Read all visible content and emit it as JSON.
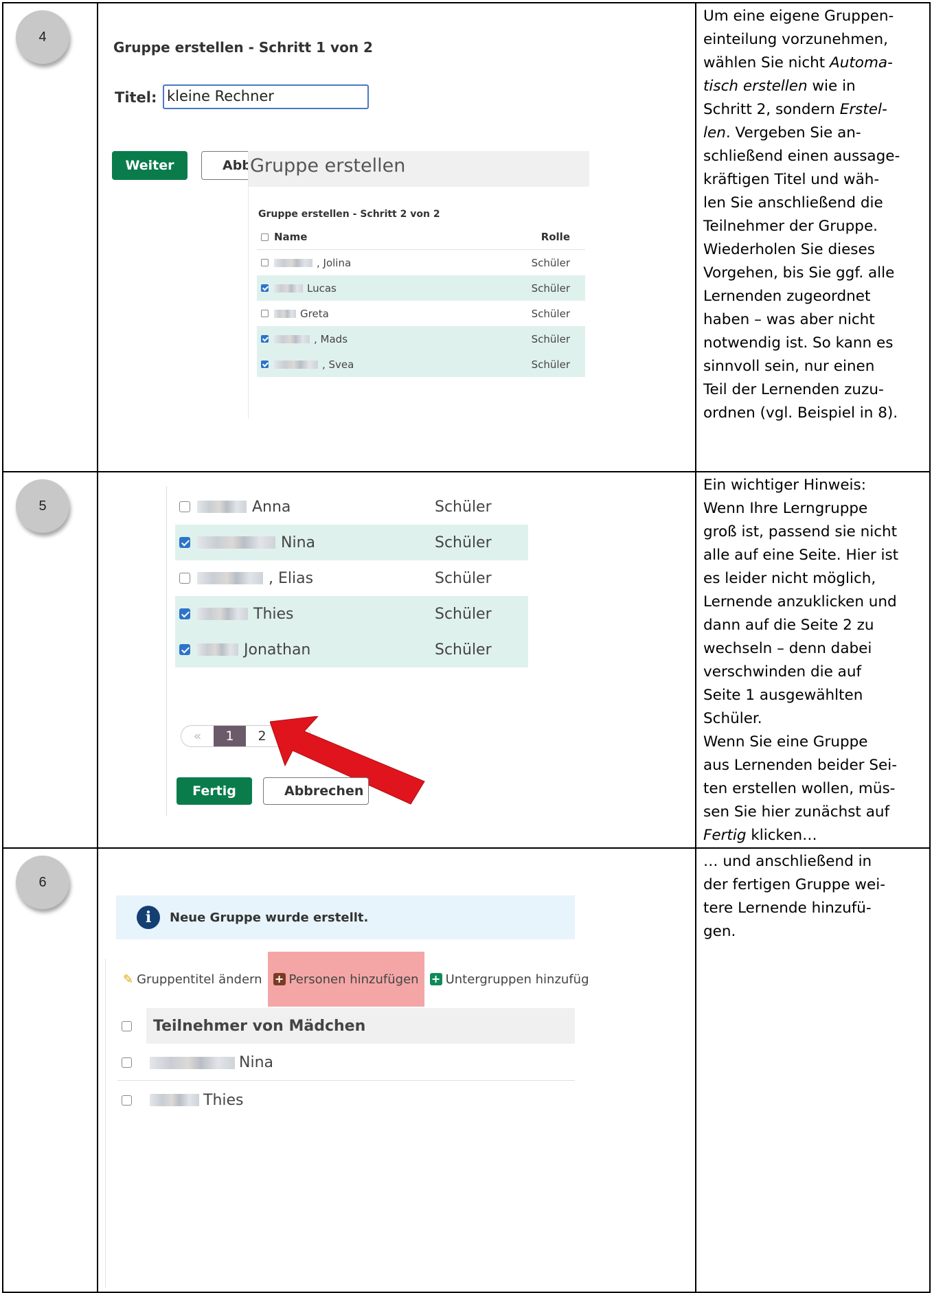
{
  "rows": [
    {
      "step": "4",
      "desc": [
        {
          "t": "Um eine eigene Gruppen-"
        },
        {
          "t": "einteilung vorzunehmen,"
        },
        {
          "t": "wählen Sie nicht ",
          "i": "Automa-"
        },
        {
          "i": "tisch erstellen",
          "t2": " wie in"
        },
        {
          "t": "Schritt 2, sondern ",
          "i": "Erstel-"
        },
        {
          "i": "len",
          "t2": ". Vergeben Sie an-"
        },
        {
          "t": "schließend einen aussage-"
        },
        {
          "t": "kräftigen Titel und wäh-"
        },
        {
          "t": "len Sie anschließend die"
        },
        {
          "t": "Teilnehmer der Gruppe."
        },
        {
          "t": "Wiederholen Sie dieses"
        },
        {
          "t": "Vorgehen, bis Sie ggf. alle"
        },
        {
          "t": "Lernenden zugeordnet"
        },
        {
          "t": "haben – was aber nicht"
        },
        {
          "t": "notwendig ist. So kann es"
        },
        {
          "t": "sinnvoll sein, nur einen"
        },
        {
          "t": "Teil der Lernenden zuzu-"
        },
        {
          "t": "ordnen (vgl. Beispiel in 8)."
        }
      ]
    },
    {
      "step": "5",
      "desc": [
        {
          "t": "Ein wichtiger Hinweis:"
        },
        {
          "t": "Wenn Ihre Lerngruppe"
        },
        {
          "t": "groß ist, passend sie nicht"
        },
        {
          "t": "alle auf eine Seite. Hier ist"
        },
        {
          "t": "es leider nicht möglich,"
        },
        {
          "t": "Lernende anzuklicken und"
        },
        {
          "t": "dann auf die Seite 2 zu"
        },
        {
          "t": "wechseln – denn dabei"
        },
        {
          "t": "verschwinden die auf"
        },
        {
          "t": "Seite 1 ausgewählten"
        },
        {
          "t": "Schüler."
        },
        {
          "t": "Wenn Sie eine Gruppe"
        },
        {
          "t": "aus Lernenden beider Sei-"
        },
        {
          "t": "ten erstellen wollen, müs-"
        },
        {
          "t": "sen Sie hier zunächst auf"
        },
        {
          "i": "Fertig",
          "t2": " klicken…"
        }
      ]
    },
    {
      "step": "6",
      "desc": [
        {
          "t": "… und anschließend in"
        },
        {
          "t": "der fertigen Gruppe wei-"
        },
        {
          "t": "tere Lernende hinzufü-"
        },
        {
          "t": "gen."
        }
      ]
    }
  ],
  "step1": {
    "title": "Gruppe erstellen - Schritt 1 von 2",
    "label": "Titel:",
    "input_value": "kleine Rechner",
    "next": "Weiter",
    "cancel": "Abbre"
  },
  "step2": {
    "panel_title": "Gruppe erstellen",
    "subtitle": "Gruppe erstellen - Schritt 2 von 2",
    "col_name": "Name",
    "col_role": "Rolle",
    "people": [
      {
        "name": ", Jolina",
        "role": "Schüler",
        "checked": false
      },
      {
        "name": "Lucas",
        "role": "Schüler",
        "checked": true
      },
      {
        "name": "Greta",
        "role": "Schüler",
        "checked": false
      },
      {
        "name": ", Mads",
        "role": "Schüler",
        "checked": true
      },
      {
        "name": ", Svea",
        "role": "Schüler",
        "checked": true
      }
    ]
  },
  "page1": {
    "people": [
      {
        "name": "Anna",
        "role": "Schüler",
        "checked": false
      },
      {
        "name": "Nina",
        "role": "Schüler",
        "checked": true
      },
      {
        "name": ", Elias",
        "role": "Schüler",
        "checked": false
      },
      {
        "name": "Thies",
        "role": "Schüler",
        "checked": true
      },
      {
        "name": "Jonathan",
        "role": "Schüler",
        "checked": true
      }
    ],
    "pager": {
      "prev": "«",
      "p1": "1",
      "p2": "2",
      "next": "»"
    },
    "done": "Fertig",
    "cancel": "Abbrechen"
  },
  "group": {
    "info": "Neue Gruppe wurde erstellt.",
    "edit_title": "Gruppentitel ändern",
    "add_people": "Personen hinzufügen",
    "add_sub": "Untergruppen hinzufüg",
    "members_head": "Teilnehmer von Mädchen",
    "members": [
      "Nina",
      "Thies"
    ]
  },
  "colors": {
    "green": "#0a7c4c",
    "selected_row": "#dff1ec",
    "highlight": "#f4a6a6",
    "arrow": "#e0141c",
    "pager_active": "#6b5b6a"
  }
}
